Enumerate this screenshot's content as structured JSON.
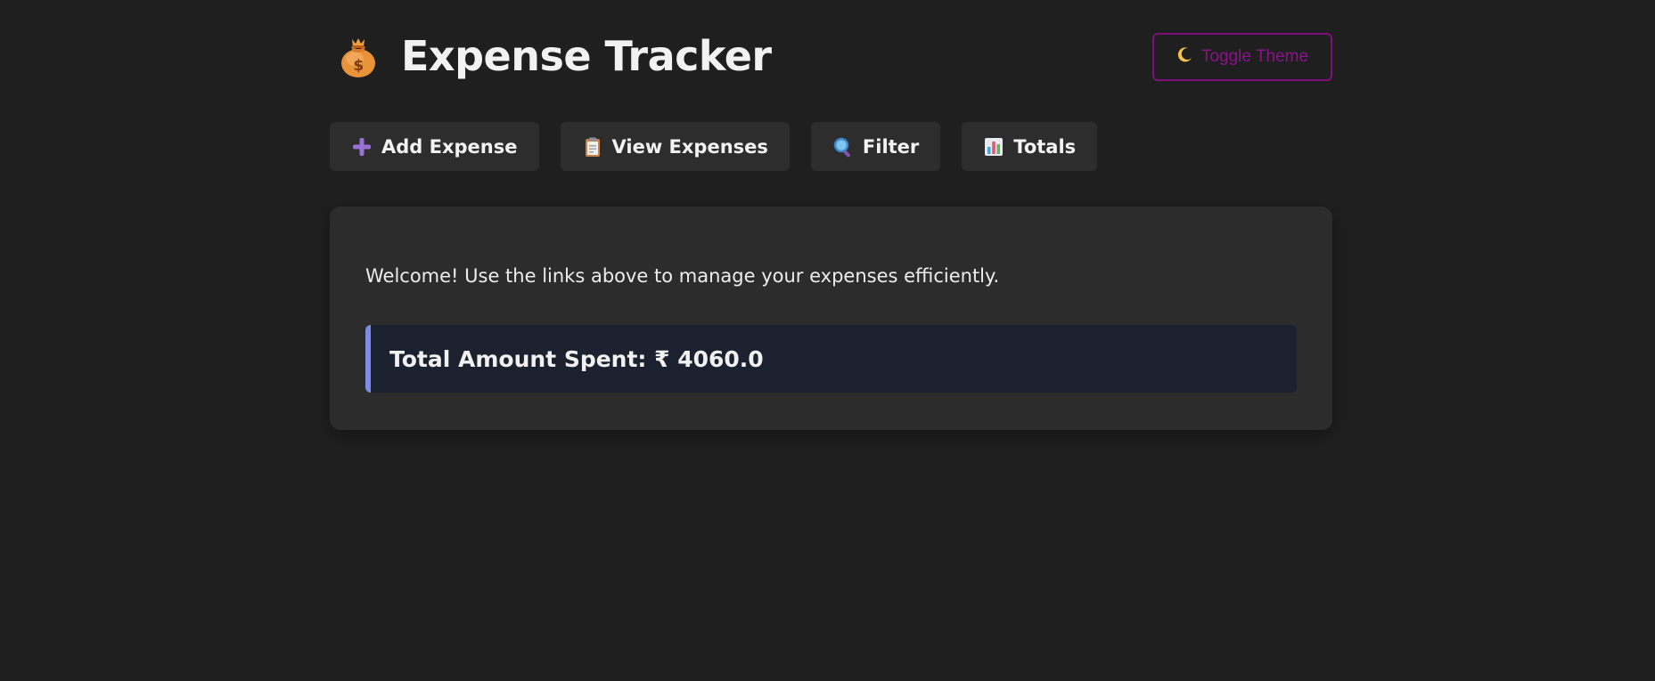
{
  "header": {
    "title": "Expense Tracker",
    "title_icon": "money-bag-icon",
    "theme_toggle": {
      "label": "Toggle Theme",
      "icon": "crescent-moon-icon",
      "color": "#8a128a"
    }
  },
  "nav": {
    "items": [
      {
        "label": "Add Expense",
        "icon": "plus-icon"
      },
      {
        "label": "View Expenses",
        "icon": "clipboard-icon"
      },
      {
        "label": "Filter",
        "icon": "magnifier-icon"
      },
      {
        "label": "Totals",
        "icon": "bar-chart-icon"
      }
    ]
  },
  "main": {
    "welcome_text": "Welcome! Use the links above to manage your expenses efficiently.",
    "total": {
      "label": "Total Amount Spent: ₹ 4060.0",
      "accent_color": "#7b8be6"
    }
  },
  "colors": {
    "background": "#1f1f1f",
    "card": "#2c2c2c",
    "button": "#2d2d2d",
    "total_box": "#1c2130"
  }
}
